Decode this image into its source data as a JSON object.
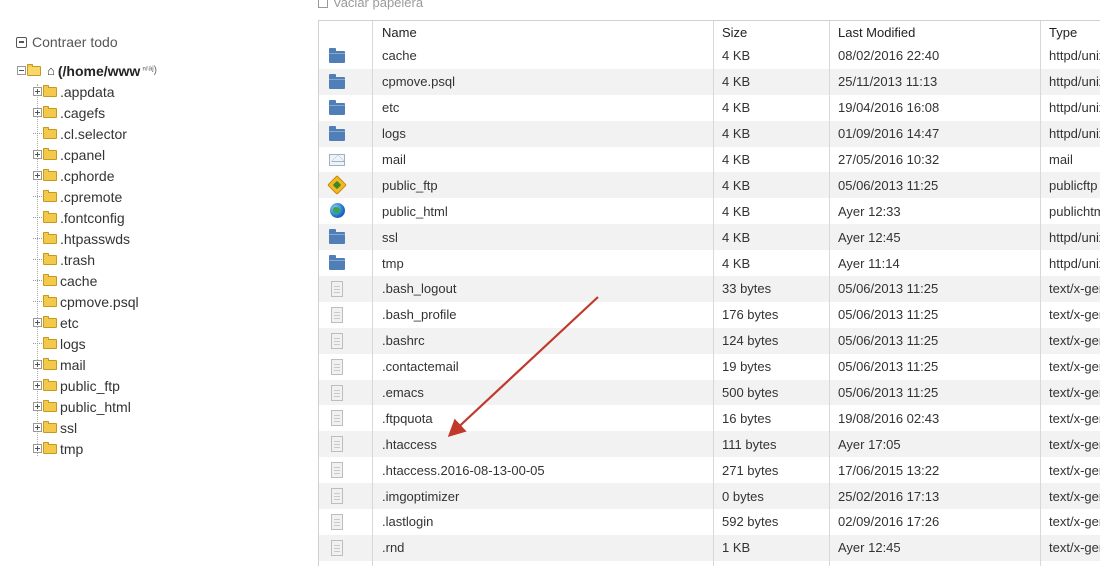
{
  "toolbar": {
    "empty_trash_label": "Vaciar papelera"
  },
  "tree": {
    "collapse_label": "Contraer todo",
    "root_label": "(/home/www",
    "root_suffix": "ⁿʳᵃʲ)",
    "items": [
      {
        "label": ".appdata",
        "expandable": true
      },
      {
        "label": ".cagefs",
        "expandable": true
      },
      {
        "label": ".cl.selector",
        "expandable": false
      },
      {
        "label": ".cpanel",
        "expandable": true
      },
      {
        "label": ".cphorde",
        "expandable": true
      },
      {
        "label": ".cpremote",
        "expandable": false
      },
      {
        "label": ".fontconfig",
        "expandable": false
      },
      {
        "label": ".htpasswds",
        "expandable": false
      },
      {
        "label": ".trash",
        "expandable": false
      },
      {
        "label": "cache",
        "expandable": false
      },
      {
        "label": "cpmove.psql",
        "expandable": false
      },
      {
        "label": "etc",
        "expandable": true
      },
      {
        "label": "logs",
        "expandable": false
      },
      {
        "label": "mail",
        "expandable": true
      },
      {
        "label": "public_ftp",
        "expandable": true
      },
      {
        "label": "public_html",
        "expandable": true
      },
      {
        "label": "ssl",
        "expandable": true
      },
      {
        "label": "tmp",
        "expandable": true
      }
    ]
  },
  "table": {
    "headers": {
      "name": "Name",
      "size": "Size",
      "modified": "Last Modified",
      "type": "Type"
    },
    "rows": [
      {
        "icon": "folder",
        "name": "cache",
        "size": "4 KB",
        "modified": "08/02/2016 22:40",
        "type": "httpd/unix-directory"
      },
      {
        "icon": "folder",
        "name": "cpmove.psql",
        "size": "4 KB",
        "modified": "25/11/2013 11:13",
        "type": "httpd/unix-directory"
      },
      {
        "icon": "folder",
        "name": "etc",
        "size": "4 KB",
        "modified": "19/04/2016 16:08",
        "type": "httpd/unix-directory"
      },
      {
        "icon": "folder",
        "name": "logs",
        "size": "4 KB",
        "modified": "01/09/2016 14:47",
        "type": "httpd/unix-directory"
      },
      {
        "icon": "mail",
        "name": "mail",
        "size": "4 KB",
        "modified": "27/05/2016 10:32",
        "type": "mail"
      },
      {
        "icon": "ftp",
        "name": "public_ftp",
        "size": "4 KB",
        "modified": "05/06/2013 11:25",
        "type": "publicftp"
      },
      {
        "icon": "globe",
        "name": "public_html",
        "size": "4 KB",
        "modified": "Ayer 12:33",
        "type": "publichtml"
      },
      {
        "icon": "folder",
        "name": "ssl",
        "size": "4 KB",
        "modified": "Ayer 12:45",
        "type": "httpd/unix-directory"
      },
      {
        "icon": "folder",
        "name": "tmp",
        "size": "4 KB",
        "modified": "Ayer 11:14",
        "type": "httpd/unix-directory"
      },
      {
        "icon": "file",
        "name": ".bash_logout",
        "size": "33 bytes",
        "modified": "05/06/2013 11:25",
        "type": "text/x-generic"
      },
      {
        "icon": "file",
        "name": ".bash_profile",
        "size": "176 bytes",
        "modified": "05/06/2013 11:25",
        "type": "text/x-generic"
      },
      {
        "icon": "file",
        "name": ".bashrc",
        "size": "124 bytes",
        "modified": "05/06/2013 11:25",
        "type": "text/x-generic"
      },
      {
        "icon": "file",
        "name": ".contactemail",
        "size": "19 bytes",
        "modified": "05/06/2013 11:25",
        "type": "text/x-generic"
      },
      {
        "icon": "file",
        "name": ".emacs",
        "size": "500 bytes",
        "modified": "05/06/2013 11:25",
        "type": "text/x-generic"
      },
      {
        "icon": "file",
        "name": ".ftpquota",
        "size": "16 bytes",
        "modified": "19/08/2016 02:43",
        "type": "text/x-generic"
      },
      {
        "icon": "file",
        "name": ".htaccess",
        "size": "111 bytes",
        "modified": "Ayer 17:05",
        "type": "text/x-generic"
      },
      {
        "icon": "file",
        "name": ".htaccess.2016-08-13-00-05",
        "size": "271 bytes",
        "modified": "17/06/2015 13:22",
        "type": "text/x-generic"
      },
      {
        "icon": "file",
        "name": ".imgoptimizer",
        "size": "0 bytes",
        "modified": "25/02/2016 17:13",
        "type": "text/x-generic"
      },
      {
        "icon": "file",
        "name": ".lastlogin",
        "size": "592 bytes",
        "modified": "02/09/2016 17:26",
        "type": "text/x-generic"
      },
      {
        "icon": "file",
        "name": ".rnd",
        "size": "1 KB",
        "modified": "Ayer 12:45",
        "type": "text/x-generic"
      }
    ]
  },
  "colors": {
    "annotation_arrow": "#c0392b",
    "folder_blue": "#4f7fb6",
    "tree_folder": "#f3c94b"
  }
}
